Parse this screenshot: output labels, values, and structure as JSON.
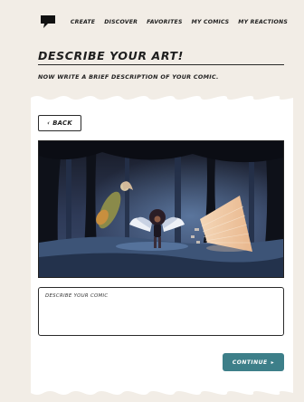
{
  "nav": {
    "items": [
      "CREATE",
      "DISCOVER",
      "FAVORITES",
      "MY COMICS",
      "MY REACTIONS"
    ]
  },
  "page": {
    "title": "DESCRIBE YOUR ART!",
    "subtitle": "NOW WRITE A BRIEF DESCRIPTION OF YOUR COMIC."
  },
  "back_button": {
    "label": "BACK"
  },
  "description": {
    "placeholder": "DESCRIBE YOUR COMIC",
    "value": ""
  },
  "continue_button": {
    "label": "CONTINUE"
  },
  "colors": {
    "background": "#f2ede6",
    "accent": "#3d7f89",
    "text": "#1e1e1e"
  }
}
